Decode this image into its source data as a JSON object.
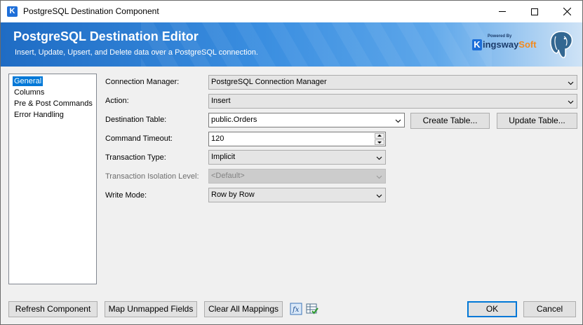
{
  "window": {
    "title": "PostgreSQL Destination Component"
  },
  "banner": {
    "title": "PostgreSQL Destination Editor",
    "subtitle": "Insert, Update, Upsert, and Delete data over a PostgreSQL connection.",
    "brand_powered": "Powered By",
    "brand_name_k": "K",
    "brand_name_mid": "ingsway",
    "brand_name_soft": "Soft"
  },
  "nav": {
    "items": [
      {
        "label": "General",
        "selected": true
      },
      {
        "label": "Columns",
        "selected": false
      },
      {
        "label": "Pre & Post Commands",
        "selected": false
      },
      {
        "label": "Error Handling",
        "selected": false
      }
    ]
  },
  "form": {
    "connection_manager": {
      "label": "Connection Manager:",
      "value": "PostgreSQL Connection Manager"
    },
    "action": {
      "label": "Action:",
      "value": "Insert"
    },
    "destination_table": {
      "label": "Destination Table:",
      "value": "public.Orders"
    },
    "command_timeout": {
      "label": "Command Timeout:",
      "value": "120"
    },
    "transaction_type": {
      "label": "Transaction Type:",
      "value": "Implicit"
    },
    "isolation_level": {
      "label": "Transaction Isolation Level:",
      "value": "<Default>",
      "disabled": true
    },
    "write_mode": {
      "label": "Write Mode:",
      "value": "Row by Row"
    },
    "create_table_button": "Create Table...",
    "update_table_button": "Update Table..."
  },
  "footer": {
    "refresh_button": "Refresh Component",
    "map_unmapped_button": "Map Unmapped Fields",
    "clear_mappings_button": "Clear All Mappings",
    "ok_button": "OK",
    "cancel_button": "Cancel"
  },
  "icons": {
    "app": "kingswaysoft-k-icon",
    "minimize": "minimize-icon",
    "maximize": "maximize-icon",
    "close": "close-icon",
    "postgres": "postgresql-elephant-icon",
    "expression": "fx-expression-icon",
    "grid": "grid-check-icon",
    "dropdown": "chevron-down-icon"
  },
  "colors": {
    "accent": "#0078d7",
    "banner": "#1f6cc4",
    "brand_orange": "#f28a1e"
  }
}
